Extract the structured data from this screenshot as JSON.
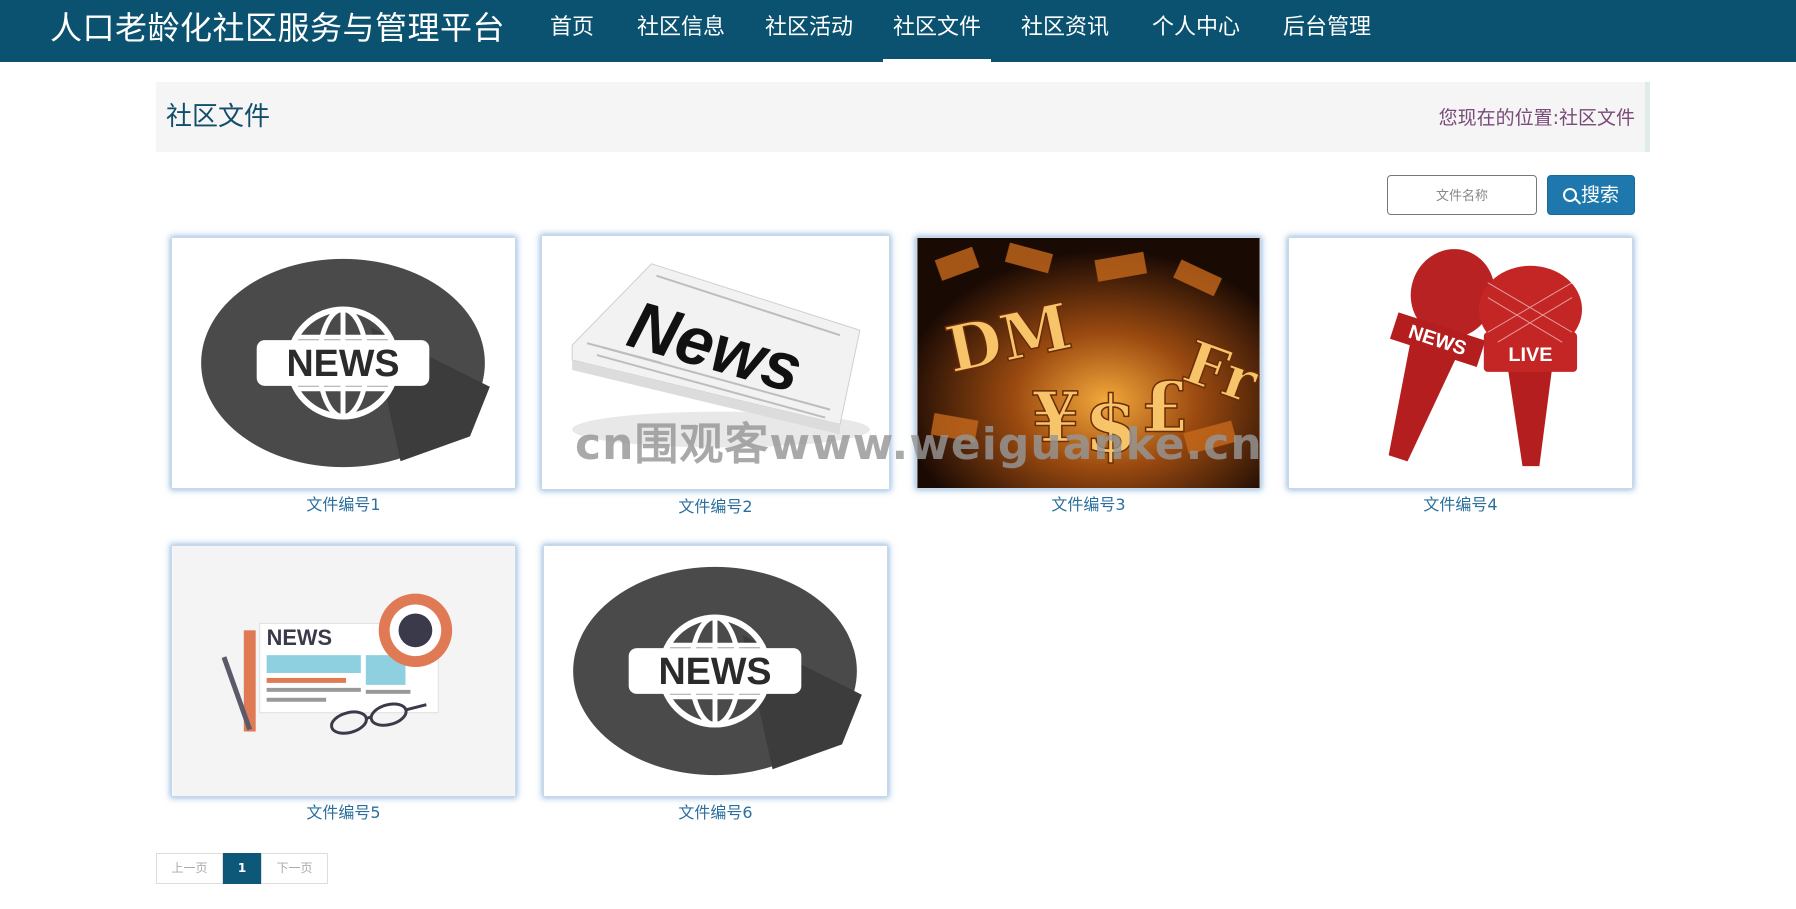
{
  "header": {
    "site_title": "人口老龄化社区服务与管理平台",
    "nav": [
      {
        "label": "首页",
        "active": false
      },
      {
        "label": "社区信息",
        "active": false
      },
      {
        "label": "社区活动",
        "active": false
      },
      {
        "label": "社区文件",
        "active": true
      },
      {
        "label": "社区资讯",
        "active": false
      },
      {
        "label": "个人中心",
        "active": false
      },
      {
        "label": "后台管理",
        "active": false
      }
    ]
  },
  "page": {
    "title": "社区文件",
    "location_label": "您现在的位置:",
    "location_value": "社区文件"
  },
  "search": {
    "placeholder": "文件名称",
    "button_label": "搜索"
  },
  "files": [
    {
      "title": "文件编号1",
      "image": "news-globe-icon"
    },
    {
      "title": "文件编号2",
      "image": "newspaper-news-image"
    },
    {
      "title": "文件编号3",
      "image": "currency-symbols-image"
    },
    {
      "title": "文件编号4",
      "image": "news-live-microphones-image"
    },
    {
      "title": "文件编号5",
      "image": "news-desk-illustration"
    },
    {
      "title": "文件编号6",
      "image": "news-globe-icon"
    }
  ],
  "watermark": "cn围观客www.weiguanke.cn",
  "pagination": {
    "prev_label": "上一页",
    "current_page": "1",
    "next_label": "下一页"
  },
  "colors": {
    "header_bg": "#0a5270",
    "accent": "#1e78ad",
    "link": "#2a6f9e"
  }
}
